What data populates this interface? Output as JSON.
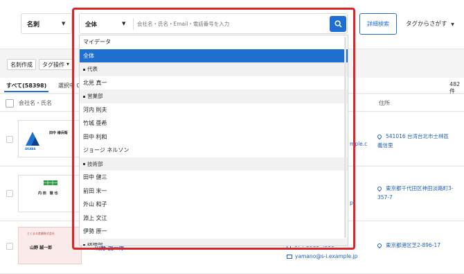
{
  "header": {
    "category_select": "名刺",
    "advanced_search": "詳細検索",
    "tag_search": "タグからさがす"
  },
  "search": {
    "scope_selected": "全体",
    "placeholder": "会社名・氏名・Email・電話番号を入力"
  },
  "toolbar": {
    "create_card": "名刺作成",
    "tag_ops": "タグ操作"
  },
  "tabs": {
    "all": "すべて(58398)",
    "selected": "選択中 0"
  },
  "results_count": "482 件",
  "table": {
    "col_name": "会社名・氏名",
    "col_address": "住所"
  },
  "dropdown": {
    "items": [
      {
        "label": "マイデータ",
        "kind": "item"
      },
      {
        "label": "全体",
        "kind": "selected"
      },
      {
        "label": "代表",
        "kind": "group"
      },
      {
        "label": "北見 真一",
        "kind": "item"
      },
      {
        "label": "営業部",
        "kind": "group"
      },
      {
        "label": "河内 則夫",
        "kind": "item"
      },
      {
        "label": "竹城 亜希",
        "kind": "item"
      },
      {
        "label": "田中 利和",
        "kind": "item"
      },
      {
        "label": "ジョージ ネルソン",
        "kind": "item"
      },
      {
        "label": "技術部",
        "kind": "group"
      },
      {
        "label": "田中 健三",
        "kind": "item"
      },
      {
        "label": "前田 末一",
        "kind": "item"
      },
      {
        "label": "外山 和子",
        "kind": "item"
      },
      {
        "label": "淵上 文江",
        "kind": "item"
      },
      {
        "label": "伊勢 原一",
        "kind": "item"
      },
      {
        "label": "経理部",
        "kind": "group"
      }
    ]
  },
  "rows": [
    {
      "card_company": "AKABA",
      "card_name": "田中 様兵衛",
      "email_fragment": "mple.c",
      "address": "541016 台湾台北市士林區義信里"
    },
    {
      "card_name": "内 田　徹 也",
      "email_fragment": "p",
      "address": "東京都千代田区神田淡路町3-357-7"
    },
    {
      "card_company": "とくまる産業株式会社",
      "card_name": "山野 誠一郎",
      "name": "山野 誠一郎",
      "phone": "074-5983-4338",
      "email": "yamano@s-i.example.jp",
      "address": "東京都港区芝2-896-17"
    }
  ],
  "colors": {
    "accent": "#1f6fd1",
    "highlight_frame": "#d6262c"
  }
}
